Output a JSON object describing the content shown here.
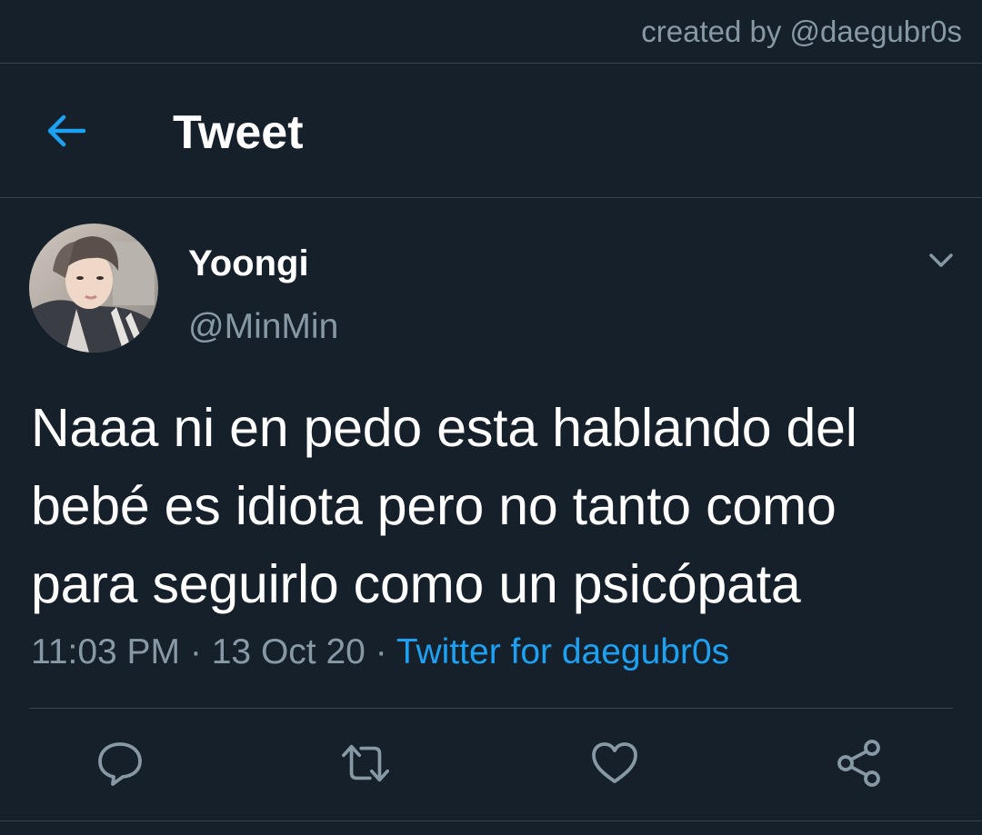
{
  "credit": "created by @daegubr0s",
  "header": {
    "title": "Tweet",
    "back_icon": "arrow-left-icon"
  },
  "tweet": {
    "display_name": "Yoongi",
    "handle": "@MinMin",
    "text": "Naaa ni en pedo esta hablando del bebé es idiota pero no tanto como para seguirlo como un psicópata",
    "time": "11:03 PM",
    "separator": "·",
    "date": "13 Oct 20",
    "source": "Twitter for daegubr0s"
  },
  "actions": [
    "reply-icon",
    "retweet-icon",
    "like-icon",
    "share-icon"
  ],
  "colors": {
    "background": "#15202b",
    "accent": "#1da1f2",
    "muted": "#8899a6",
    "border": "#38444d"
  }
}
